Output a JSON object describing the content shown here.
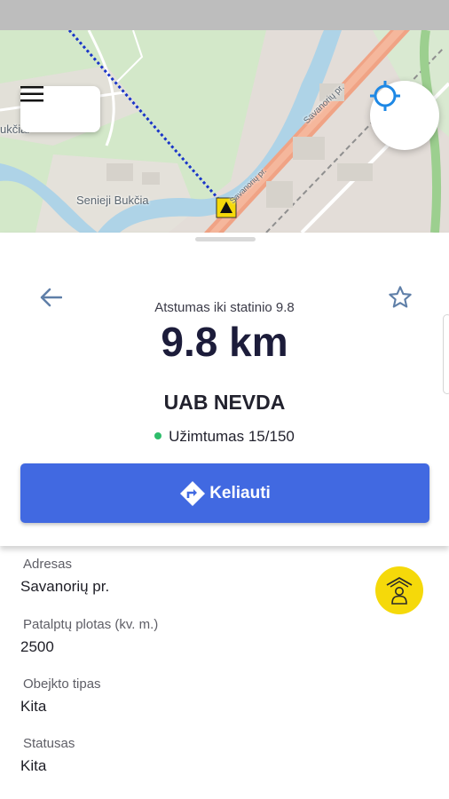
{
  "map": {
    "labels": {
      "town_bukciai": "ukčiai",
      "town_senieji": "Senieji Bukčia",
      "street_main": "Savanorių pr.",
      "street_small": "Savanorių pr."
    },
    "icons": {
      "menu": "hamburger-menu-icon",
      "locate": "crosshair-locate-icon",
      "marker": "warning-marker-icon"
    },
    "colors": {
      "route": "#1a35c8",
      "road": "#f0a385",
      "river": "#aed3e7",
      "forest": "#c9e4bf"
    }
  },
  "sheet": {
    "distance_caption": "Atstumas iki statinio 9.8",
    "distance_value": "9.8 km",
    "company_name": "UAB NEVDA",
    "occupancy_text": "Užimtumas 15/150",
    "occupancy_color": "#2ebd6b",
    "travel_label": "Keliauti",
    "accent_color": "#4169e1"
  },
  "details": {
    "fields": [
      {
        "label": "Adresas",
        "value": "Savanorių pr."
      },
      {
        "label": "Patalptų plotas (kv. m.)",
        "value": "2500"
      },
      {
        "label": "Obejkto tipas",
        "value": "Kita"
      },
      {
        "label": "Statusas",
        "value": "Kita"
      }
    ],
    "owner_icon": "person-home-icon",
    "owner_color": "#f5d90a"
  }
}
